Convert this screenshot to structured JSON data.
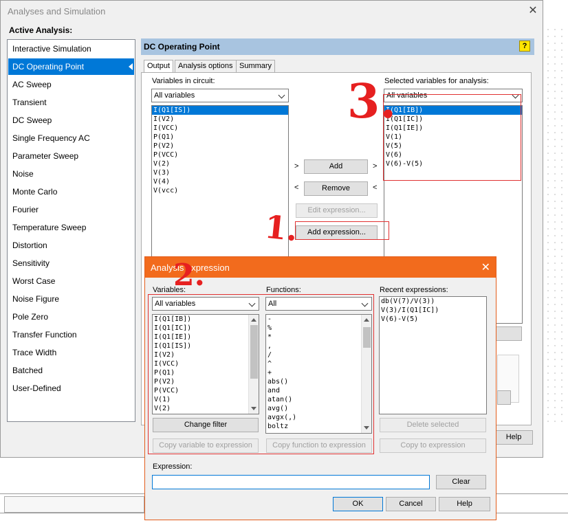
{
  "main_dialog": {
    "title": "Analyses and Simulation",
    "active_analysis_label": "Active Analysis:",
    "nav_items": [
      "Interactive Simulation",
      "DC Operating Point",
      "AC Sweep",
      "Transient",
      "DC Sweep",
      "Single Frequency AC",
      "Parameter Sweep",
      "Noise",
      "Monte Carlo",
      "Fourier",
      "Temperature Sweep",
      "Distortion",
      "Sensitivity",
      "Worst Case",
      "Noise Figure",
      "Pole Zero",
      "Transfer Function",
      "Trace Width",
      "Batched",
      "User-Defined"
    ],
    "selected_nav": "DC Operating Point",
    "panel_title": "DC Operating Point",
    "help_icon": "?",
    "tabs": [
      "Output",
      "Analysis options",
      "Summary"
    ],
    "active_tab": "Output",
    "variables_label": "Variables in circuit:",
    "variables_filter": "All variables",
    "variables": [
      "I(Q1[IS])",
      "I(V2)",
      "I(VCC)",
      "P(Q1)",
      "P(V2)",
      "P(VCC)",
      "V(2)",
      "V(3)",
      "V(4)",
      "V(vcc)"
    ],
    "selected_label": "Selected variables for analysis:",
    "selected_filter": "All variables",
    "selected_vars": [
      "I(Q1[IB])",
      "I(Q1[IC])",
      "I(Q1[IE])",
      "V(1)",
      "V(5)",
      "V(6)",
      "V(6)-V(5)"
    ],
    "add_label": "Add",
    "remove_label": "Remove",
    "edit_expr_label": "Edit expression...",
    "add_expr_label": "Add expression...",
    "help_label": "Help",
    "arrow_right": ">",
    "arrow_left": "<"
  },
  "expression_dialog": {
    "title": "Analysis expression",
    "variables_label": "Variables:",
    "variables_filter": "All variables",
    "variables": [
      "I(Q1[IB])",
      "I(Q1[IC])",
      "I(Q1[IE])",
      "I(Q1[IS])",
      "I(V2)",
      "I(VCC)",
      "P(Q1)",
      "P(V2)",
      "P(VCC)",
      "V(1)",
      "V(2)"
    ],
    "functions_label": "Functions:",
    "functions_filter": "All",
    "functions": [
      "-",
      "%",
      "*",
      ",",
      "/",
      "^",
      "+",
      "abs()",
      "and",
      "atan()",
      "avg()",
      "avgx(,)",
      "boltz"
    ],
    "recent_label": "Recent expressions:",
    "recent": [
      "db(V(7)/V(3))",
      "V(3)/I(Q1[IC])",
      "V(6)-V(5)"
    ],
    "change_filter_label": "Change filter",
    "copy_variable_label": "Copy variable to expression",
    "copy_function_label": "Copy function to expression",
    "delete_selected_label": "Delete selected",
    "copy_to_expr_label": "Copy to expression",
    "expression_label": "Expression:",
    "expression_value": "",
    "clear_label": "Clear",
    "ok_label": "OK",
    "cancel_label": "Cancel",
    "help_label": "Help"
  },
  "annotations": {
    "mark1": "1.",
    "mark2": "2.",
    "mark3": "3."
  },
  "colors": {
    "accent": "#0078d7",
    "dialog_bar": "#f26b1d",
    "annotation": "#e03030",
    "panel_head": "#a8c4e0"
  }
}
